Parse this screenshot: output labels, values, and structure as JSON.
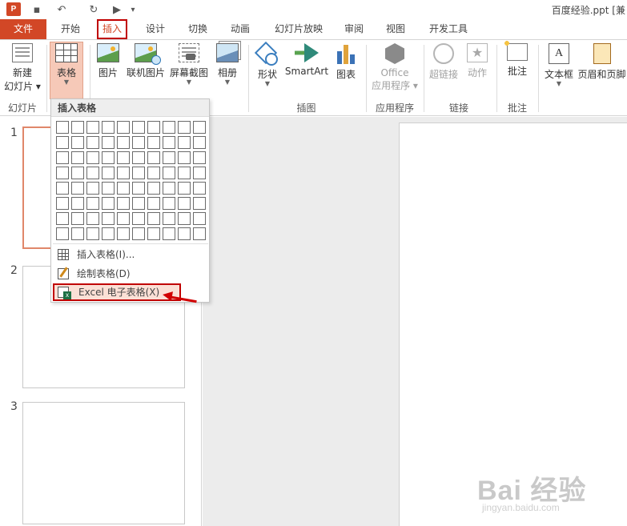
{
  "window": {
    "title": "百度经验.ppt [兼"
  },
  "quick_access": {
    "logo": "P",
    "save_icon": "save-icon",
    "undo_icon": "undo-icon",
    "redo_icon": "redo-icon",
    "present_icon": "present-icon",
    "customize": "▾"
  },
  "tabs": [
    {
      "label": "文件"
    },
    {
      "label": "开始"
    },
    {
      "label": "插入"
    },
    {
      "label": "设计"
    },
    {
      "label": "切换"
    },
    {
      "label": "动画"
    },
    {
      "label": "幻灯片放映"
    },
    {
      "label": "审阅"
    },
    {
      "label": "视图"
    },
    {
      "label": "开发工具"
    }
  ],
  "ribbon": {
    "new_slide": {
      "line1": "新建",
      "line2": "幻灯片"
    },
    "table": {
      "label": "表格"
    },
    "picture": {
      "label": "图片"
    },
    "online_picture": {
      "label": "联机图片"
    },
    "screenshot": {
      "label": "屏幕截图"
    },
    "album": {
      "label": "相册"
    },
    "shapes": {
      "label": "形状"
    },
    "smartart": {
      "label": "SmartArt"
    },
    "chart": {
      "label": "图表"
    },
    "office_apps": {
      "line1": "Office",
      "line2": "应用程序"
    },
    "hyperlink": {
      "label": "超链接"
    },
    "action": {
      "label": "动作"
    },
    "comment": {
      "label": "批注"
    },
    "textbox": {
      "label": "文本框"
    },
    "header_footer": {
      "label": "页眉和页脚"
    },
    "groups": {
      "slides": "幻灯片",
      "illustrations": "插图",
      "apps": "应用程序",
      "links": "链接",
      "comments": "批注"
    }
  },
  "dropdown": {
    "header": "插入表格",
    "grid": {
      "columns": 10,
      "rows": 8
    },
    "items": [
      {
        "label": "插入表格(I)..."
      },
      {
        "label": "绘制表格(D)"
      },
      {
        "label": "Excel 电子表格(X)"
      }
    ]
  },
  "thumbnails": [
    {
      "number": "1"
    },
    {
      "number": "2"
    },
    {
      "number": "3"
    }
  ],
  "watermark": {
    "main": "Bai 经验",
    "sub": "jingyan.baidu.com"
  },
  "colors": {
    "accent": "#d24726",
    "highlight_box": "#c00000",
    "active_button": "#f6c9b8"
  }
}
